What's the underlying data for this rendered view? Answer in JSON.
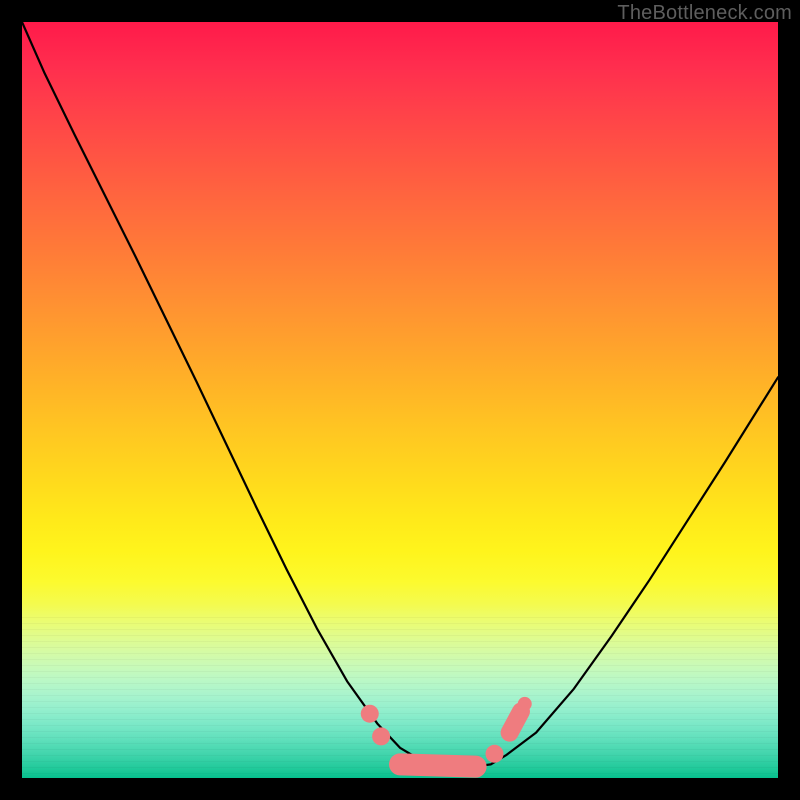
{
  "watermark": "TheBottleneck.com",
  "chart_data": {
    "type": "line",
    "title": "",
    "xlabel": "",
    "ylabel": "",
    "xlim": [
      0,
      1
    ],
    "ylim": [
      0,
      1
    ],
    "grid": false,
    "legend": false,
    "annotations": [],
    "background_gradient": {
      "direction": "top-to-bottom",
      "stops": [
        {
          "pos": 0.0,
          "color": "#ff1a4a"
        },
        {
          "pos": 0.5,
          "color": "#ffb622"
        },
        {
          "pos": 0.72,
          "color": "#fff41c"
        },
        {
          "pos": 1.0,
          "color": "#06c08e"
        }
      ]
    },
    "series": [
      {
        "name": "bottleneck-curve",
        "x": [
          0.0,
          0.03,
          0.07,
          0.11,
          0.15,
          0.19,
          0.23,
          0.27,
          0.31,
          0.35,
          0.39,
          0.43,
          0.47,
          0.5,
          0.53,
          0.56,
          0.59,
          0.62,
          0.64,
          0.68,
          0.73,
          0.78,
          0.83,
          0.88,
          0.93,
          0.98,
          1.0
        ],
        "y": [
          1.0,
          0.932,
          0.85,
          0.77,
          0.69,
          0.608,
          0.526,
          0.442,
          0.358,
          0.276,
          0.198,
          0.128,
          0.072,
          0.04,
          0.022,
          0.015,
          0.014,
          0.018,
          0.03,
          0.06,
          0.118,
          0.188,
          0.262,
          0.34,
          0.418,
          0.498,
          0.53
        ],
        "color": "#000000",
        "linewidth": 2.2
      }
    ],
    "markers": {
      "color": "#ef7c7f",
      "items": [
        {
          "x": 0.46,
          "y": 0.085,
          "r": 9
        },
        {
          "x": 0.475,
          "y": 0.055,
          "r": 9
        },
        {
          "x": 0.5,
          "y": 0.018,
          "r": 11,
          "segment_to": {
            "x": 0.6,
            "y": 0.015
          }
        },
        {
          "x": 0.625,
          "y": 0.032,
          "r": 9
        },
        {
          "x": 0.645,
          "y": 0.06,
          "r": 9,
          "segment_to": {
            "x": 0.66,
            "y": 0.088
          }
        },
        {
          "x": 0.665,
          "y": 0.098,
          "r": 7
        }
      ]
    },
    "minimum_point": {
      "x": 0.57,
      "y": 0.013
    }
  }
}
